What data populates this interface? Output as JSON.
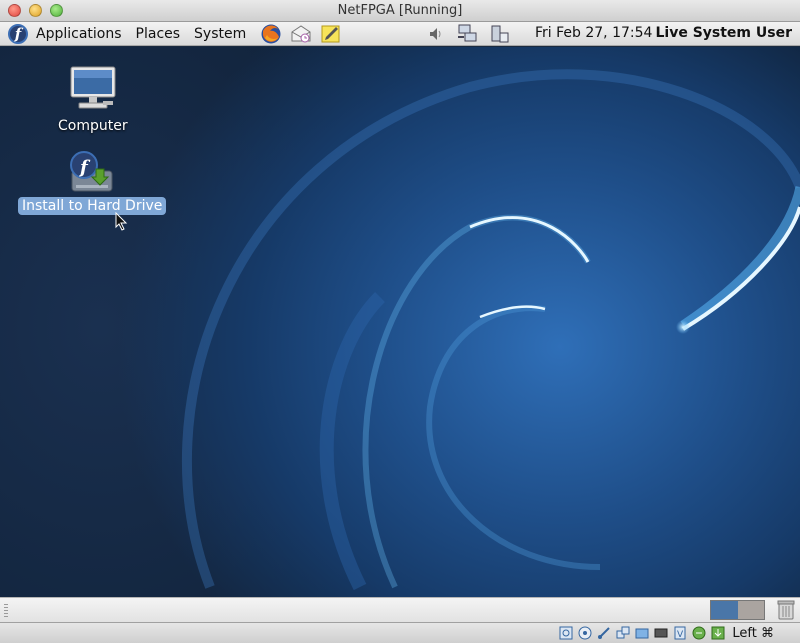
{
  "window": {
    "title": "NetFPGA [Running]"
  },
  "panel": {
    "menus": [
      "Applications",
      "Places",
      "System"
    ],
    "launchers": [
      "firefox-icon",
      "mail-icon",
      "notes-icon"
    ],
    "tray": [
      "volume-icon",
      "network-icon",
      "system-icon"
    ],
    "clock": "Fri Feb 27, 17:54",
    "user": "Live System User"
  },
  "desktop": {
    "icons": [
      {
        "label": "Computer",
        "icon": "computer-icon",
        "selected": false
      },
      {
        "label": "Install to Hard Drive",
        "icon": "install-icon",
        "selected": true
      }
    ]
  },
  "vbox": {
    "hostkey": "Left ⌘"
  },
  "colors": {
    "selection": "#7fa7d6",
    "fedora_blue": "#294172",
    "workspace_active": "#4a76a8"
  }
}
